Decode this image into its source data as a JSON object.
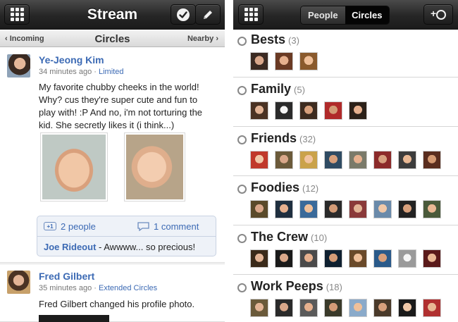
{
  "left": {
    "title": "Stream",
    "nav": {
      "left": "‹ Incoming",
      "center": "Circles",
      "right": "Nearby ›"
    },
    "posts": [
      {
        "author": "Ye-Jeong Kim",
        "time": "34 minutes ago",
        "separator": " · ",
        "circle": "Limited",
        "text": "My favorite chubby cheeks in the world! Why? cus they're super cute and fun to play with! :P And no, i'm not torturing the kid. She secretly likes it (i think...)",
        "plus_label": "+1",
        "plus_count": "2 people",
        "comment_count": "1 comment",
        "top_comment_author": "Joe Rideout",
        "top_comment_text": " - Awwww... so precious!"
      },
      {
        "author": "Fred Gilbert",
        "time": "35 minutes ago",
        "separator": " · ",
        "circle": "Extended Circles",
        "text": "Fred Gilbert changed his profile photo."
      }
    ]
  },
  "right": {
    "segments": [
      "People",
      "Circles"
    ],
    "active_segment": "Circles",
    "add_button": "+",
    "circles": [
      {
        "name": "Bests",
        "count": "(3)",
        "faces": 3
      },
      {
        "name": "Family",
        "count": "(5)",
        "faces": 5
      },
      {
        "name": "Friends",
        "count": "(32)",
        "faces": 8
      },
      {
        "name": "Foodies",
        "count": "(12)",
        "faces": 8
      },
      {
        "name": "The Crew",
        "count": "(10)",
        "faces": 8
      },
      {
        "name": "Work Peeps",
        "count": "(18)",
        "faces": 8
      }
    ]
  },
  "colors": {
    "link_blue": "#3c6ab4",
    "topbar_dark": "#1b1b1b",
    "actions_bg": "#eef2f8"
  }
}
